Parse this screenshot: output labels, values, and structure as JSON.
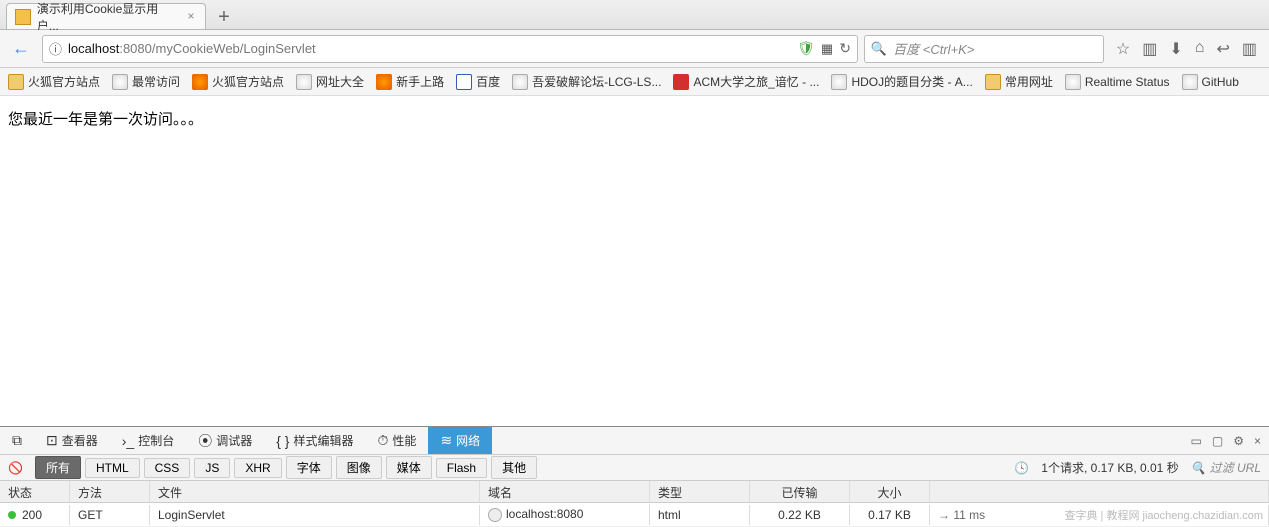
{
  "tabs": {
    "active_title": "演示利用Cookie显示用户..."
  },
  "url": {
    "host": "localhost",
    "port": ":8080",
    "path": "/myCookieWeb/LoginServlet"
  },
  "search": {
    "placeholder": "百度 <Ctrl+K>"
  },
  "bookmarks": [
    {
      "label": "火狐官方站点",
      "icon": "folder"
    },
    {
      "label": "最常访问",
      "icon": "globe"
    },
    {
      "label": "火狐官方站点",
      "icon": "ff"
    },
    {
      "label": "网址大全",
      "icon": "globe"
    },
    {
      "label": "新手上路",
      "icon": "ff"
    },
    {
      "label": "百度",
      "icon": "baidu"
    },
    {
      "label": "吾爱破解论坛-LCG-LS...",
      "icon": "globe"
    },
    {
      "label": "ACM大学之旅_谙忆 - ...",
      "icon": "red"
    },
    {
      "label": "HDOJ的题目分类 - A...",
      "icon": "globe"
    },
    {
      "label": "常用网址",
      "icon": "folder"
    },
    {
      "label": "Realtime Status",
      "icon": "globe"
    },
    {
      "label": "GitHub",
      "icon": "globe"
    }
  ],
  "page_content": "您最近一年是第一次访问。。。",
  "devtools": {
    "tabs": [
      "查看器",
      "控制台",
      "调试器",
      "样式编辑器",
      "性能",
      "网络"
    ],
    "filters": [
      "所有",
      "HTML",
      "CSS",
      "JS",
      "XHR",
      "字体",
      "图像",
      "媒体",
      "Flash",
      "其他"
    ],
    "summary": "1个请求, 0.17 KB, 0.01 秒",
    "filter_placeholder": "过滤 URL",
    "headers": {
      "status": "状态",
      "method": "方法",
      "file": "文件",
      "domain": "域名",
      "type": "类型",
      "transferred": "已传输",
      "size": "大小"
    },
    "row": {
      "status": "200",
      "method": "GET",
      "file": "LoginServlet",
      "domain": "localhost:8080",
      "type": "html",
      "transferred": "0.22 KB",
      "size": "0.17 KB",
      "time": "→ 11 ms"
    }
  },
  "watermark": "查字典 | 教程网\njiaocheng.chazidian.com"
}
